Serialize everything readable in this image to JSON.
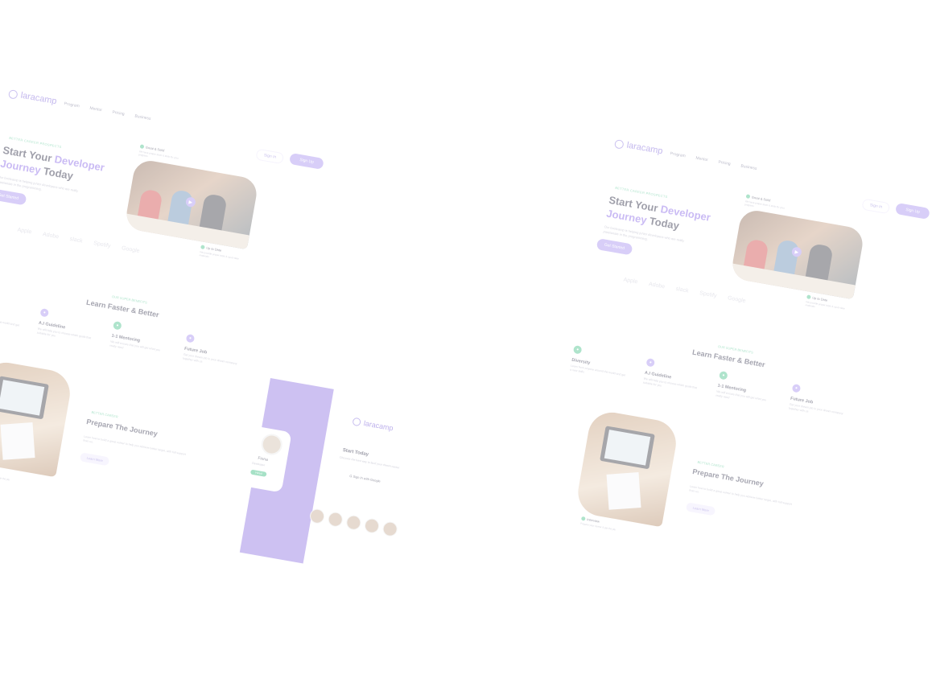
{
  "nav": {
    "logo": "laracamp",
    "links": [
      "Program",
      "Mentor",
      "Pricing",
      "Business"
    ],
    "signin": "Sign In",
    "signup": "Sign Up"
  },
  "hero": {
    "kicker": "BETTER CAREER PROSPECTS",
    "title_part1": "Start Your ",
    "title_accent1": "Developer",
    "title_accent2": "Journey",
    "title_part2": " Today",
    "desc": "Our bootcamp is helping junior developers who are really passionate in the programming.",
    "cta": "Get Started",
    "badge_top_title": "Great & Solid",
    "badge_top_sub": "We have proper team & tools for your progress",
    "badge_bottom_title": "Up to Date",
    "badge_bottom_sub": "We provide proper tools & up-to-date materials"
  },
  "brands": [
    "Apple",
    "Adobe",
    "slack",
    "Spotify",
    "Google"
  ],
  "features": {
    "kicker": "OUR SUPER BENEFITS",
    "title": "Learn Faster & Better",
    "items": [
      {
        "title": "Diversity",
        "desc": "Learn from anyone around the world and get a new skills",
        "color": "#4fc48f"
      },
      {
        "title": "A.I Guideline",
        "desc": "We will help you to choose which goals that suitable for you",
        "color": "#a994f0"
      },
      {
        "title": "1-1 Mentoring",
        "desc": "We will ensure that you will get what you really need",
        "color": "#4fc48f"
      },
      {
        "title": "Future Job",
        "desc": "Get your dream job in your dream company together with us",
        "color": "#a994f0"
      }
    ]
  },
  "journey": {
    "kicker": "BETTER CAREER",
    "title": "Prepare The Journey",
    "desc": "Learn how to build a great career to help you achieve better target, with full support from us.",
    "cta": "Learn More",
    "badge_title": "Interview",
    "badge_sub": "Prepare your career & get the job"
  },
  "signup_card": {
    "logo": "laracamp",
    "title": "Start Today",
    "sub": "Discover the best way to land your dream career",
    "google": "Sign In with Google",
    "profile_name": "Fiona",
    "profile_role": "Developer",
    "profile_status": "Hired"
  }
}
